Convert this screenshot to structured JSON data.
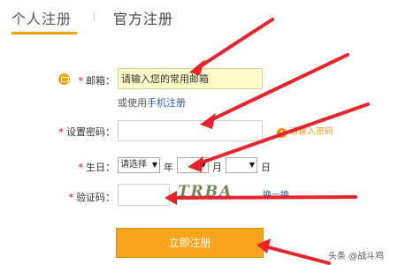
{
  "tabs": {
    "active": "个人注册",
    "inactive": "官方注册"
  },
  "form": {
    "email_label": "邮箱：",
    "email_value": "请输入您的常用邮箱",
    "alt_prefix": "或使用",
    "alt_link": "手机注册",
    "password_label": "设置密码：",
    "password_hint": "请输入密码",
    "birthday_label": "生日：",
    "year_select": "请选择",
    "year_unit": "年",
    "month_select": "",
    "month_unit": "月",
    "day_select": "",
    "day_unit": "日",
    "captcha_label": "验证码：",
    "captcha_text": "TRBA",
    "refresh_link": "换一换",
    "submit_label": "立即注册",
    "required_mark": "*"
  },
  "watermark": "头条 @战斗鸡",
  "colors": {
    "accent": "#f5a000",
    "required": "#e60012",
    "link": "#2a5db0",
    "arrow": "#e8232b"
  },
  "icons": {
    "email": "email-icon",
    "hint": "warning-icon",
    "dropdown": "chevron-down-icon"
  }
}
